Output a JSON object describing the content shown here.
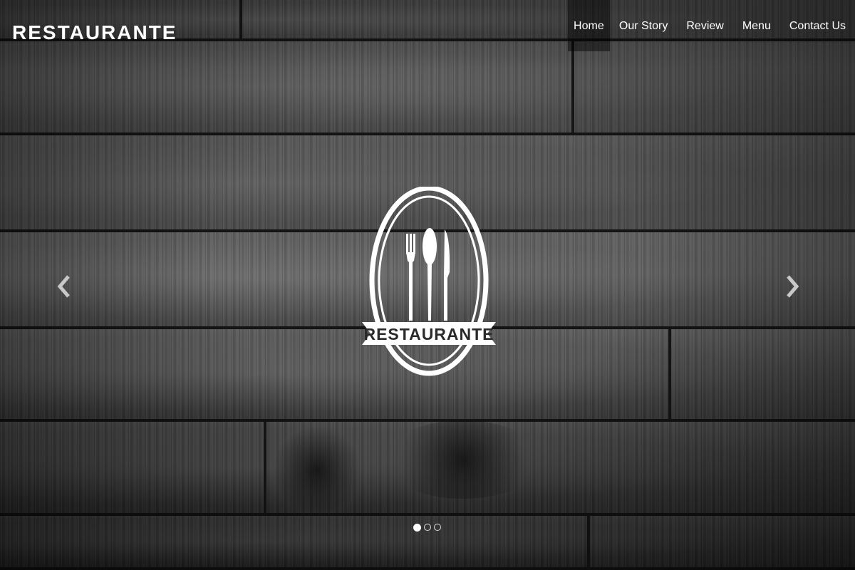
{
  "brand": {
    "logo_text": "RESTAURANTE"
  },
  "nav": {
    "items": [
      {
        "label": "Home",
        "active": true
      },
      {
        "label": "Our Story",
        "active": false
      },
      {
        "label": "Review",
        "active": false
      },
      {
        "label": "Menu",
        "active": false
      },
      {
        "label": "Contact Us",
        "active": false
      }
    ]
  },
  "hero": {
    "emblem_text": "RESTAURANTE",
    "emblem_icons": [
      "fork-icon",
      "spoon-icon",
      "knife-icon"
    ],
    "prev_icon": "chevron-left-icon",
    "next_icon": "chevron-right-icon",
    "slides_total": 3,
    "active_slide": 1
  },
  "colors": {
    "text": "#ffffff",
    "background": "#4a4a4a"
  }
}
